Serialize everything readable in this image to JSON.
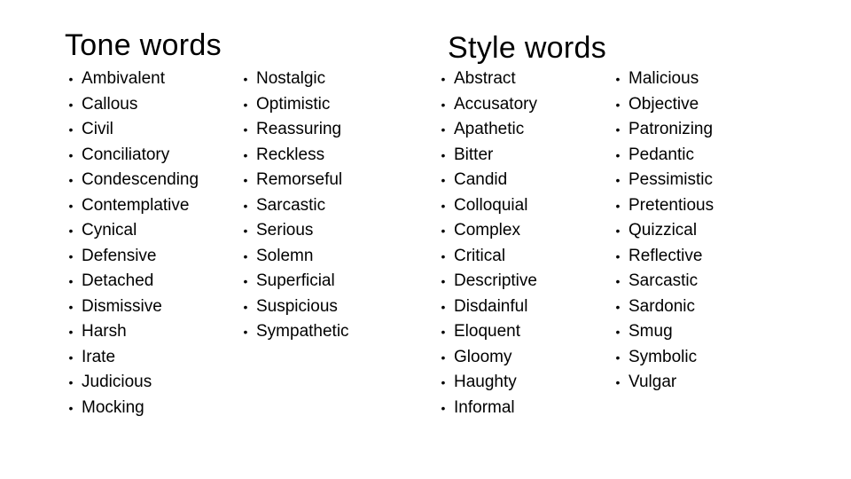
{
  "tone": {
    "title": "Tone words",
    "column1": [
      "Ambivalent",
      "Callous",
      "Civil",
      "Conciliatory",
      "Condescending",
      "Contemplative",
      "Cynical",
      "Defensive",
      "Detached",
      "Dismissive",
      "Harsh",
      "Irate",
      "Judicious",
      "Mocking"
    ],
    "column2": [
      "Nostalgic",
      "Optimistic",
      "Reassuring",
      "Reckless",
      "Remorseful",
      "Sarcastic",
      "Serious",
      "Solemn",
      "Superficial",
      "Suspicious",
      "Sympathetic"
    ]
  },
  "style": {
    "title": "Style words",
    "column1": [
      "Abstract",
      "Accusatory",
      "Apathetic",
      "Bitter",
      "Candid",
      "Colloquial",
      "Complex",
      "Critical",
      "Descriptive",
      "Disdainful",
      "Eloquent",
      "Gloomy",
      "Haughty",
      "Informal"
    ],
    "column2": [
      "Malicious",
      "Objective",
      "Patronizing",
      "Pedantic",
      "Pessimistic",
      "Pretentious",
      "Quizzical",
      "Reflective",
      "Sarcastic",
      "Sardonic",
      "Smug",
      "Symbolic",
      "Vulgar"
    ]
  },
  "bullet_glyph": "•"
}
